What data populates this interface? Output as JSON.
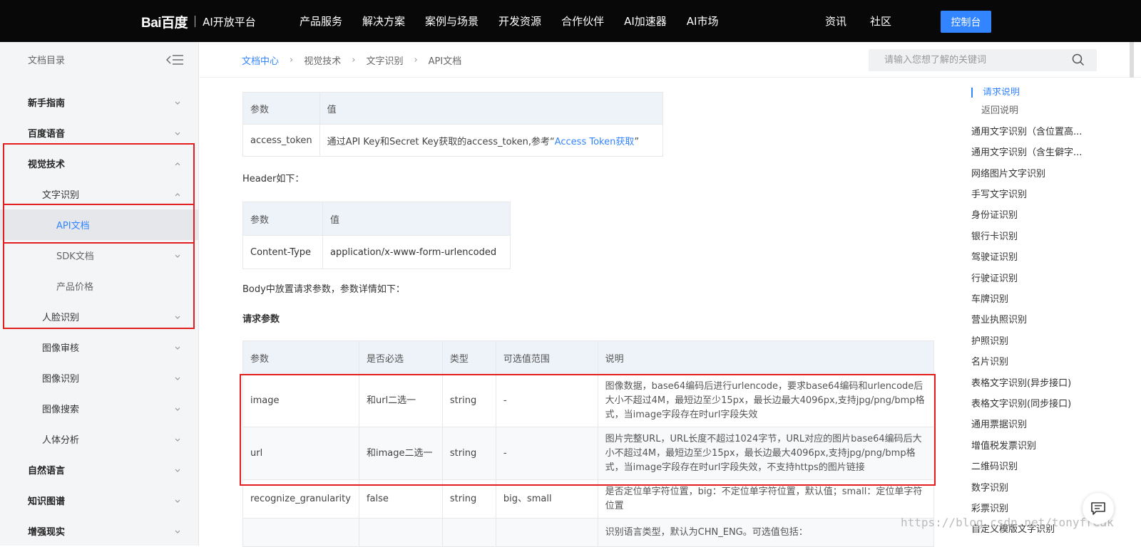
{
  "nav": {
    "logo_text": "Bai百度",
    "platform": "AI开放平台",
    "items": [
      "产品服务",
      "解决方案",
      "案例与场景",
      "开发资源",
      "合作伙伴",
      "AI加速器",
      "AI市场"
    ],
    "right_items": [
      "资讯",
      "社区"
    ],
    "console_label": "控制台"
  },
  "sidebar": {
    "title": "文档目录",
    "items": [
      {
        "label": "新手指南",
        "chev": "down"
      },
      {
        "label": "百度语音",
        "chev": "down"
      },
      {
        "label": "视觉技术",
        "chev": "up"
      },
      {
        "label": "文字识别",
        "chev": "up"
      },
      {
        "label": "API文档",
        "chev": ""
      },
      {
        "label": "SDK文档",
        "chev": "down"
      },
      {
        "label": "产品价格",
        "chev": ""
      },
      {
        "label": "人脸识别",
        "chev": "down"
      },
      {
        "label": "图像审核",
        "chev": "down"
      },
      {
        "label": "图像识别",
        "chev": "down"
      },
      {
        "label": "图像搜索",
        "chev": "down"
      },
      {
        "label": "人体分析",
        "chev": "down"
      },
      {
        "label": "自然语言",
        "chev": "down"
      },
      {
        "label": "知识图谱",
        "chev": "down"
      },
      {
        "label": "增强现实",
        "chev": "down"
      }
    ]
  },
  "breadcrumb": [
    "文档中心",
    "视觉技术",
    "文字识别",
    "API文档"
  ],
  "search": {
    "placeholder": "请输入您想了解的关键词"
  },
  "main": {
    "table1": {
      "headers": [
        "参数",
        "值"
      ],
      "param": "access_token",
      "value_text": "通过API Key和Secret Key获取的access_token,参考“",
      "value_link": "Access Token获取",
      "value_end": "”"
    },
    "header_intro": "Header如下：",
    "table2": {
      "headers": [
        "参数",
        "值"
      ],
      "param": "Content-Type",
      "value": "application/x-www-form-urlencoded"
    },
    "body_intro": "Body中放置请求参数，参数详情如下：",
    "req_title": "请求参数",
    "table3": {
      "headers": [
        "参数",
        "是否必选",
        "类型",
        "可选值范围",
        "说明"
      ],
      "rows": [
        {
          "param": "image",
          "required": "和url二选一",
          "type": "string",
          "range": "-",
          "desc": "图像数据，base64编码后进行urlencode，要求base64编码和urlencode后大小不超过4M，最短边至少15px，最长边最大4096px,支持jpg/png/bmp格式，当image字段存在时url字段失效"
        },
        {
          "param": "url",
          "required": "和image二选一",
          "type": "string",
          "range": "-",
          "desc": "图片完整URL，URL长度不超过1024字节，URL对应的图片base64编码后大小不超过4M，最短边至少15px，最长边最大4096px,支持jpg/png/bmp格式，当image字段存在时url字段失效，不支持https的图片链接"
        },
        {
          "param": "recognize_granularity",
          "required": "false",
          "type": "string",
          "range": "big、small",
          "desc": "是否定位单字符位置，big：不定位单字符位置，默认值；small：定位单字符位置"
        },
        {
          "param": "",
          "required": "",
          "type": "",
          "range": "",
          "desc": "识别语言类型，默认为CHN_ENG。可选值包括："
        }
      ]
    }
  },
  "toc": [
    "请求说明",
    "返回说明",
    "通用文字识别（含位置高...",
    "通用文字识别（含生僻字...",
    "网络图片文字识别",
    "手写文字识别",
    "身份证识别",
    "银行卡识别",
    "驾驶证识别",
    "行驶证识别",
    "车牌识别",
    "营业执照识别",
    "护照识别",
    "名片识别",
    "表格文字识别(异步接口)",
    "表格文字识别(同步接口)",
    "通用票据识别",
    "增值税发票识别",
    "二维码识别",
    "数字识别",
    "彩票识别",
    "自定义模版文字识别"
  ],
  "watermark": "https://blog.csdn.net/tonyfreak",
  "colors": {
    "accent": "#3385ff",
    "nav_bg": "#080808",
    "highlight_border": "#e41e1e"
  }
}
